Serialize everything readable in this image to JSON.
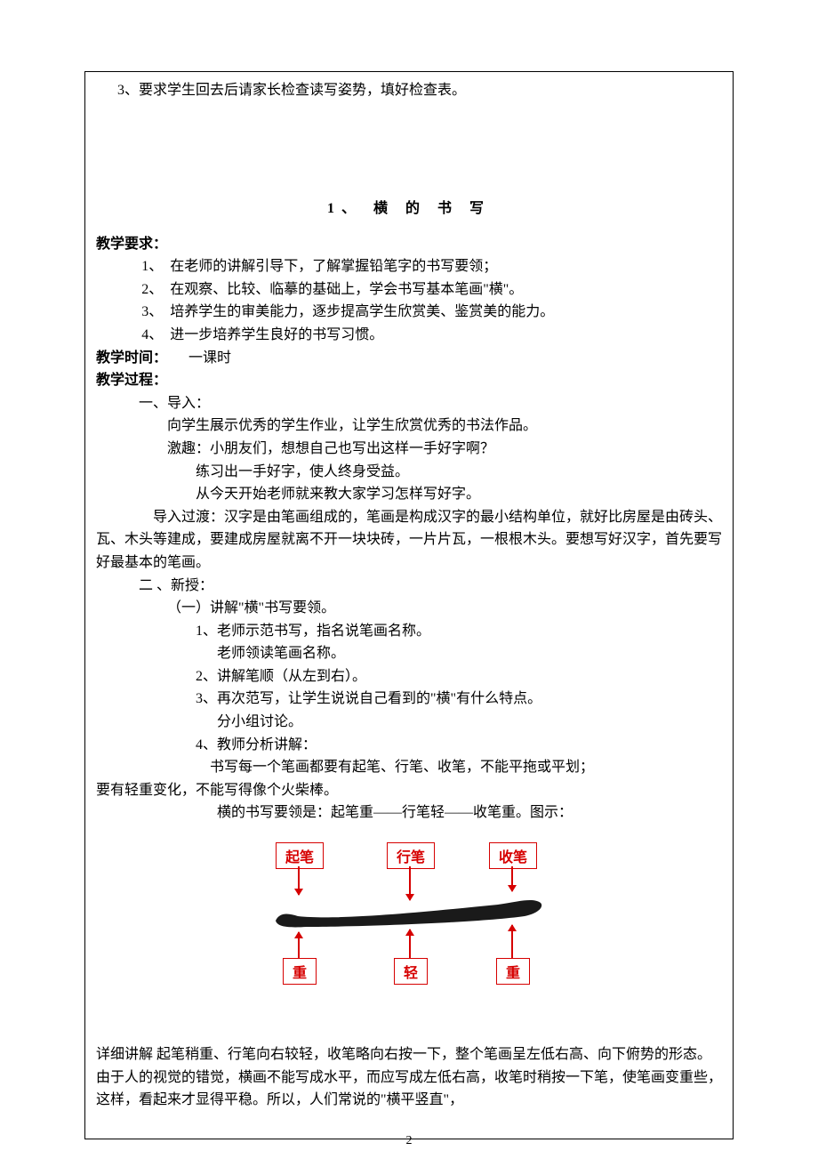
{
  "topLine": "3、要求学生回去后请家长检查读写姿势，填好检查表。",
  "title": "1、 横 的 书 写",
  "reqHeading": "教学要求：",
  "requirements": [
    {
      "num": "1、",
      "text": "在老师的讲解引导下，了解掌握铅笔字的书写要领；"
    },
    {
      "num": "2、",
      "text": "在观察、比较、临摹的基础上，学会书写基本笔画\"横\"。"
    },
    {
      "num": "3、",
      "text": "培养学生的审美能力，逐步提高学生欣赏美、鉴赏美的能力。"
    },
    {
      "num": "4、",
      "text": "进一步培养学生良好的书写习惯。"
    }
  ],
  "timeLabel": "教学时间：",
  "timeValue": "　　一课时",
  "procLabel": "教学过程：",
  "sec1": {
    "num": "一、",
    "title": "导入：",
    "lines": [
      "向学生展示优秀的学生作业，让学生欣赏优秀的书法作品。",
      "激趣：小朋友们，想想自己也写出这样一手好字啊？"
    ],
    "subLines": [
      "练习出一手好字，使人终身受益。",
      "从今天开始老师就来教大家学习怎样写好字。"
    ],
    "transition": "导入过渡：汉字是由笔画组成的，笔画是构成汉字的最小结构单位，就好比房屋是由砖头、瓦、木头等建成，要建成房屋就离不开一块块砖，一片片瓦，一根根木头。要想写好汉字，首先要写好最基本的笔画。",
    "transitionLead": "　　　　导入过渡：汉字是由笔画组成的，笔画是构成汉字的最小结构单位，"
  },
  "sec2": {
    "num": "二 、",
    "title": "新授：",
    "sub1": "（一）讲解\"横\"书写要领。",
    "items": [
      {
        "num": "1、",
        "text": "老师示范书写，指名说笔画名称。",
        "extra": "老师领读笔画名称。"
      },
      {
        "num": "2、",
        "text": "讲解笔顺（从左到右）。"
      },
      {
        "num": "3、",
        "text": "再次范写，让学生说说自己看到的\"横\"有什么特点。",
        "extra": "分小组讨论。"
      },
      {
        "num": "4、",
        "text": "教师分析讲解："
      }
    ],
    "analysisLine1": "　　　　　　　　书写每一个笔画都要有起笔、行笔、收笔，不能平拖或平划；",
    "analysisLine1b": "要有轻重变化，不能写得像个火柴棒。",
    "analysisLine2": "横的书写要领是：起笔重——行笔轻——收笔重。图示："
  },
  "diagram": {
    "top": [
      "起笔",
      "行笔",
      "收笔"
    ],
    "bottom": [
      "重",
      "轻",
      "重"
    ]
  },
  "explain1": "详细讲解 起笔稍重、行笔向右较轻，收笔略向右按一下，整个笔画呈左低右高、向下俯势的形态。",
  "explain2": "由于人的视觉的错觉，横画不能写成水平，而应写成左低右高，收笔时稍按一下笔，使笔画变重些，这样，看起来才显得平稳。所以，人们常说的\"横平竖直\"，",
  "pageNumber": "2"
}
